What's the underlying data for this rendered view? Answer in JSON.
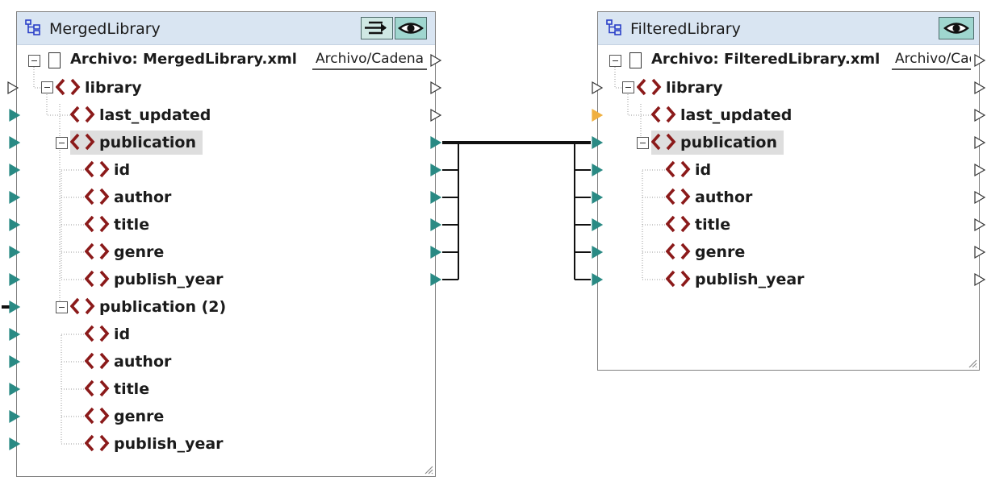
{
  "source": {
    "title": "MergedLibrary",
    "file_label": "Archivo: MergedLibrary.xml",
    "file_field": "Archivo/Cadena",
    "nodes": {
      "library": "library",
      "last_updated": "last_updated",
      "publication": "publication",
      "id": "id",
      "author": "author",
      "title": "title",
      "genre": "genre",
      "publish_year": "publish_year",
      "publication2": "publication (2)",
      "id2": "id",
      "author2": "author",
      "title2": "title",
      "genre2": "genre",
      "publish_year2": "publish_year"
    }
  },
  "target": {
    "title": "FilteredLibrary",
    "file_label": "Archivo: FilteredLibrary.xml",
    "file_field": "Archivo/Cadena",
    "nodes": {
      "library": "library",
      "last_updated": "last_updated",
      "publication": "publication",
      "id": "id",
      "author": "author",
      "title": "title",
      "genre": "genre",
      "publish_year": "publish_year"
    }
  },
  "colors": {
    "titlebar": "#d9e5f2",
    "element_icon": "#8b1a1a",
    "connector_filled": "#2a8a84",
    "connector_highlight": "#f0b040",
    "button": "#9fd6cf"
  },
  "icons": {
    "component": "component-icon",
    "element": "xml-element-icon",
    "document": "document-icon",
    "eye": "eye-icon",
    "input_output": "input-output-icon"
  }
}
